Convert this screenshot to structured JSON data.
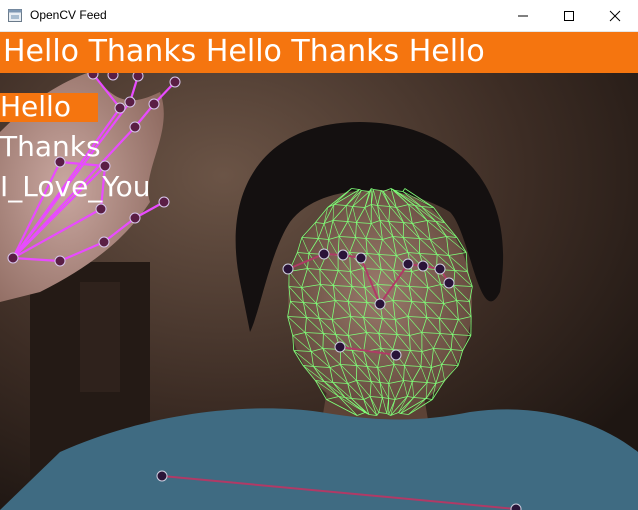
{
  "window": {
    "title": "OpenCV Feed",
    "app_icon": "opencv-window-icon",
    "controls": {
      "minimize": "minimize-icon",
      "maximize": "maximize-icon",
      "close": "close-icon"
    }
  },
  "banner": {
    "sentence": "Hello Thanks Hello Thanks Hello",
    "color": "#f5750f"
  },
  "predictions": [
    {
      "label": "Hello",
      "probability": 0.95
    },
    {
      "label": "Thanks",
      "probability": 0.0
    },
    {
      "label": "I_Love_You",
      "probability": 0.0
    }
  ],
  "overlay_colors": {
    "face_mesh": "#80ff79",
    "hand_connection": "#e84bff",
    "hand_point": "#5a1e45",
    "pose_connection": "#b03a66",
    "pose_point": "#2a1438"
  }
}
